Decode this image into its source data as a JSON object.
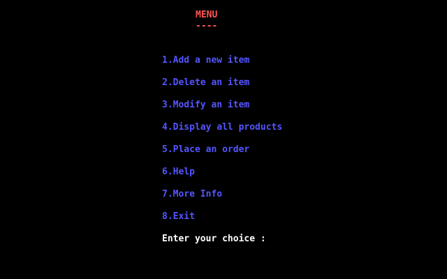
{
  "menu": {
    "title": "MENU",
    "title_underline": "----",
    "items": [
      {
        "label": "1.Add a new item"
      },
      {
        "label": "2.Delete an item"
      },
      {
        "label": "3.Modify an item"
      },
      {
        "label": "4.Display all products"
      },
      {
        "label": "5.Place an order"
      },
      {
        "label": "6.Help"
      },
      {
        "label": "7.More Info"
      },
      {
        "label": "8.Exit"
      }
    ],
    "prompt": "Enter your choice :"
  },
  "colors": {
    "background": "#000000",
    "title": "#ff5555",
    "items": "#5555ff",
    "prompt": "#ffffff"
  }
}
